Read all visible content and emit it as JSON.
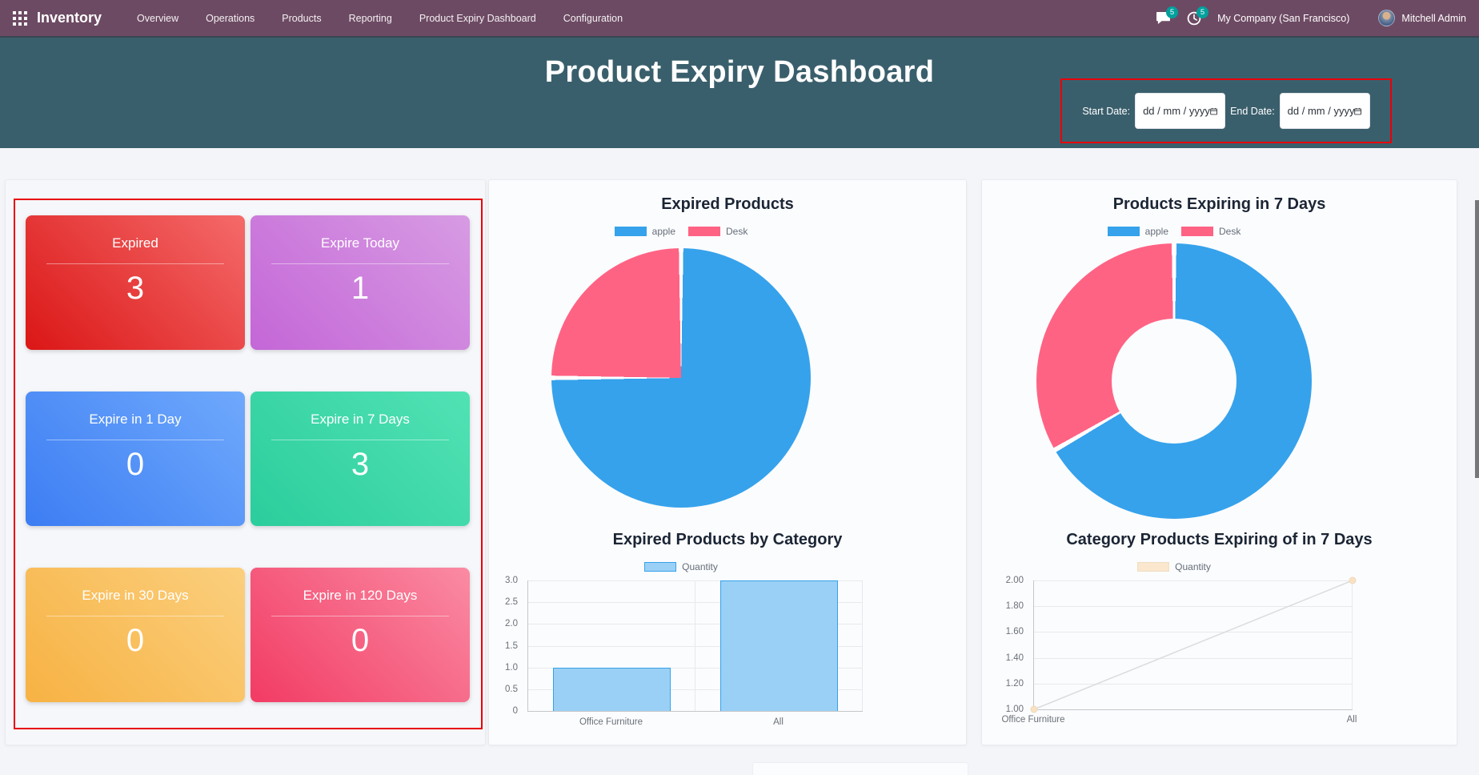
{
  "navbar": {
    "app_name": "Inventory",
    "menu_items": [
      "Overview",
      "Operations",
      "Products",
      "Reporting",
      "Product Expiry Dashboard",
      "Configuration"
    ],
    "messages_badge": "5",
    "activities_badge": "5",
    "company": "My Company (San Francisco)",
    "user": "Mitchell Admin"
  },
  "header": {
    "title": "Product Expiry Dashboard",
    "filters": {
      "start_label": "Start Date:",
      "end_label": "End Date:",
      "start_value": "dd / mm / yyyy",
      "end_value": "dd / mm / yyyy"
    }
  },
  "summary_cards": [
    {
      "label": "Expired",
      "value": "3",
      "gradient": [
        "#F56A6A",
        "#DB1616"
      ]
    },
    {
      "label": "Expire Today",
      "value": "1",
      "gradient": [
        "#D79BE3",
        "#C466D7"
      ]
    },
    {
      "label": "Expire in 1 Day",
      "value": "0",
      "gradient": [
        "#6FA9FC",
        "#3C7DF3"
      ]
    },
    {
      "label": "Expire in 7 Days",
      "value": "3",
      "gradient": [
        "#52E2B4",
        "#2BCD9C"
      ]
    },
    {
      "label": "Expire in 30 Days",
      "value": "0",
      "gradient": [
        "#FBCF7E",
        "#F7B243"
      ]
    },
    {
      "label": "Expire in 120 Days",
      "value": "0",
      "gradient": [
        "#FA8BA3",
        "#F23B64"
      ]
    }
  ],
  "chart_data": [
    {
      "type": "pie",
      "title": "Expired Products",
      "labels": [
        "apple",
        "Desk"
      ],
      "values": [
        3,
        1
      ],
      "colors": [
        "#36A2EB",
        "#FF6384"
      ],
      "legend_position": "top"
    },
    {
      "type": "bar",
      "title": "Expired Products by Category",
      "categories": [
        "Office Furniture",
        "All"
      ],
      "series": [
        {
          "name": "Quantity",
          "values": [
            1,
            3
          ]
        }
      ],
      "ylim": [
        0,
        3
      ],
      "yticks": [
        "0",
        "0.5",
        "1.0",
        "1.5",
        "2.0",
        "2.5",
        "3.0"
      ],
      "bar_fill": "#9AD0F5",
      "bar_border": "#36A2EB",
      "grid": true,
      "legend_position": "top"
    },
    {
      "type": "doughnut",
      "title": "Products Expiring in 7 Days",
      "labels": [
        "apple",
        "Desk"
      ],
      "values": [
        2,
        1
      ],
      "colors": [
        "#36A2EB",
        "#FF6384"
      ],
      "legend_position": "top"
    },
    {
      "type": "line",
      "title": "Category Products Expiring of in 7 Days",
      "categories": [
        "Office Furniture",
        "All"
      ],
      "series": [
        {
          "name": "Quantity",
          "values": [
            1.0,
            2.0
          ]
        }
      ],
      "ylim": [
        1,
        2
      ],
      "yticks": [
        "1.00",
        "1.20",
        "1.40",
        "1.60",
        "1.80",
        "2.00"
      ],
      "line_color": "#DADCDE",
      "marker_fill": "#F8E2C2",
      "marker_border": "#EFD9B8",
      "legend_fill": "#FAE7CE",
      "legend_border": "#F0DEC2",
      "grid": true,
      "legend_position": "top"
    }
  ],
  "icons": {
    "apps_menu": "3x3-grid",
    "messages": "chat-bubble",
    "activities": "clock",
    "calendar": "calendar",
    "avatar": "user-photo"
  },
  "colors": {
    "navbar_bg": "#6D4A63",
    "header_bg": "#3A5F6C",
    "badge": "#00A09D",
    "highlight_border": "#E8000B",
    "page_bg": "#F4F5F9",
    "panel_bg": "#FBFCFE"
  }
}
